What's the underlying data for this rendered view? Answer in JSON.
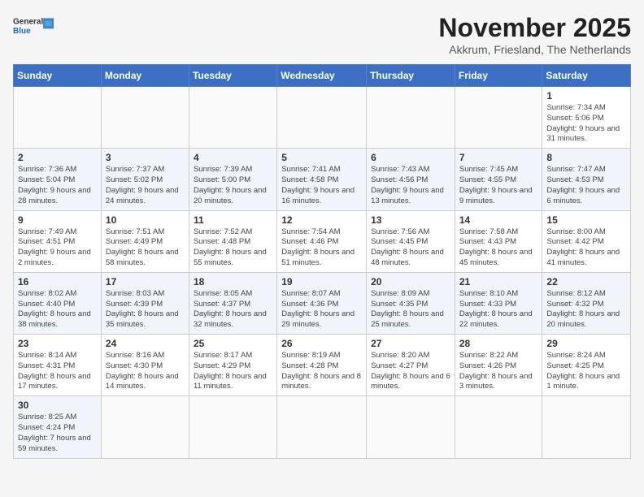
{
  "header": {
    "logo_general": "General",
    "logo_blue": "Blue",
    "month_title": "November 2025",
    "subtitle": "Akkrum, Friesland, The Netherlands"
  },
  "weekdays": [
    "Sunday",
    "Monday",
    "Tuesday",
    "Wednesday",
    "Thursday",
    "Friday",
    "Saturday"
  ],
  "weeks": [
    [
      {
        "day": "",
        "info": ""
      },
      {
        "day": "",
        "info": ""
      },
      {
        "day": "",
        "info": ""
      },
      {
        "day": "",
        "info": ""
      },
      {
        "day": "",
        "info": ""
      },
      {
        "day": "",
        "info": ""
      },
      {
        "day": "1",
        "info": "Sunrise: 7:34 AM\nSunset: 5:06 PM\nDaylight: 9 hours and 31 minutes."
      }
    ],
    [
      {
        "day": "2",
        "info": "Sunrise: 7:36 AM\nSunset: 5:04 PM\nDaylight: 9 hours and 28 minutes."
      },
      {
        "day": "3",
        "info": "Sunrise: 7:37 AM\nSunset: 5:02 PM\nDaylight: 9 hours and 24 minutes."
      },
      {
        "day": "4",
        "info": "Sunrise: 7:39 AM\nSunset: 5:00 PM\nDaylight: 9 hours and 20 minutes."
      },
      {
        "day": "5",
        "info": "Sunrise: 7:41 AM\nSunset: 4:58 PM\nDaylight: 9 hours and 16 minutes."
      },
      {
        "day": "6",
        "info": "Sunrise: 7:43 AM\nSunset: 4:56 PM\nDaylight: 9 hours and 13 minutes."
      },
      {
        "day": "7",
        "info": "Sunrise: 7:45 AM\nSunset: 4:55 PM\nDaylight: 9 hours and 9 minutes."
      },
      {
        "day": "8",
        "info": "Sunrise: 7:47 AM\nSunset: 4:53 PM\nDaylight: 9 hours and 6 minutes."
      }
    ],
    [
      {
        "day": "9",
        "info": "Sunrise: 7:49 AM\nSunset: 4:51 PM\nDaylight: 9 hours and 2 minutes."
      },
      {
        "day": "10",
        "info": "Sunrise: 7:51 AM\nSunset: 4:49 PM\nDaylight: 8 hours and 58 minutes."
      },
      {
        "day": "11",
        "info": "Sunrise: 7:52 AM\nSunset: 4:48 PM\nDaylight: 8 hours and 55 minutes."
      },
      {
        "day": "12",
        "info": "Sunrise: 7:54 AM\nSunset: 4:46 PM\nDaylight: 8 hours and 51 minutes."
      },
      {
        "day": "13",
        "info": "Sunrise: 7:56 AM\nSunset: 4:45 PM\nDaylight: 8 hours and 48 minutes."
      },
      {
        "day": "14",
        "info": "Sunrise: 7:58 AM\nSunset: 4:43 PM\nDaylight: 8 hours and 45 minutes."
      },
      {
        "day": "15",
        "info": "Sunrise: 8:00 AM\nSunset: 4:42 PM\nDaylight: 8 hours and 41 minutes."
      }
    ],
    [
      {
        "day": "16",
        "info": "Sunrise: 8:02 AM\nSunset: 4:40 PM\nDaylight: 8 hours and 38 minutes."
      },
      {
        "day": "17",
        "info": "Sunrise: 8:03 AM\nSunset: 4:39 PM\nDaylight: 8 hours and 35 minutes."
      },
      {
        "day": "18",
        "info": "Sunrise: 8:05 AM\nSunset: 4:37 PM\nDaylight: 8 hours and 32 minutes."
      },
      {
        "day": "19",
        "info": "Sunrise: 8:07 AM\nSunset: 4:36 PM\nDaylight: 8 hours and 29 minutes."
      },
      {
        "day": "20",
        "info": "Sunrise: 8:09 AM\nSunset: 4:35 PM\nDaylight: 8 hours and 25 minutes."
      },
      {
        "day": "21",
        "info": "Sunrise: 8:10 AM\nSunset: 4:33 PM\nDaylight: 8 hours and 22 minutes."
      },
      {
        "day": "22",
        "info": "Sunrise: 8:12 AM\nSunset: 4:32 PM\nDaylight: 8 hours and 20 minutes."
      }
    ],
    [
      {
        "day": "23",
        "info": "Sunrise: 8:14 AM\nSunset: 4:31 PM\nDaylight: 8 hours and 17 minutes."
      },
      {
        "day": "24",
        "info": "Sunrise: 8:16 AM\nSunset: 4:30 PM\nDaylight: 8 hours and 14 minutes."
      },
      {
        "day": "25",
        "info": "Sunrise: 8:17 AM\nSunset: 4:29 PM\nDaylight: 8 hours and 11 minutes."
      },
      {
        "day": "26",
        "info": "Sunrise: 8:19 AM\nSunset: 4:28 PM\nDaylight: 8 hours and 8 minutes."
      },
      {
        "day": "27",
        "info": "Sunrise: 8:20 AM\nSunset: 4:27 PM\nDaylight: 8 hours and 6 minutes."
      },
      {
        "day": "28",
        "info": "Sunrise: 8:22 AM\nSunset: 4:26 PM\nDaylight: 8 hours and 3 minutes."
      },
      {
        "day": "29",
        "info": "Sunrise: 8:24 AM\nSunset: 4:25 PM\nDaylight: 8 hours and 1 minute."
      }
    ],
    [
      {
        "day": "30",
        "info": "Sunrise: 8:25 AM\nSunset: 4:24 PM\nDaylight: 7 hours and 59 minutes."
      },
      {
        "day": "",
        "info": ""
      },
      {
        "day": "",
        "info": ""
      },
      {
        "day": "",
        "info": ""
      },
      {
        "day": "",
        "info": ""
      },
      {
        "day": "",
        "info": ""
      },
      {
        "day": "",
        "info": ""
      }
    ]
  ]
}
